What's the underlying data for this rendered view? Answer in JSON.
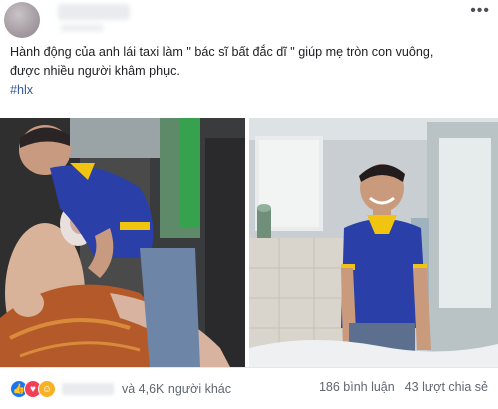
{
  "post": {
    "menu_icon": "ellipsis-icon",
    "text_line1": "Hành động của anh lái taxi làm \" bác sĩ bất đắc dĩ \" giúp mẹ tròn con vuông,",
    "text_line2": "được nhiều người khâm phục.",
    "hashtag": "#hlx"
  },
  "photos": [
    {
      "name": "taxi-driver-helping-mother-photo"
    },
    {
      "name": "smiling-taxi-driver-photo"
    }
  ],
  "footer": {
    "reaction_icons": [
      "like-icon",
      "love-icon",
      "haha-icon"
    ],
    "reactions_text": "và 4,6K người khác",
    "comments": "186 bình luận",
    "shares": "43 lượt chia sẻ"
  },
  "colors": {
    "link": "#365899",
    "shirt": "#2b3fa8",
    "shirt_trim": "#f1c40f",
    "like": "#1877f2",
    "love": "#f33e58",
    "haha": "#f7b125"
  }
}
